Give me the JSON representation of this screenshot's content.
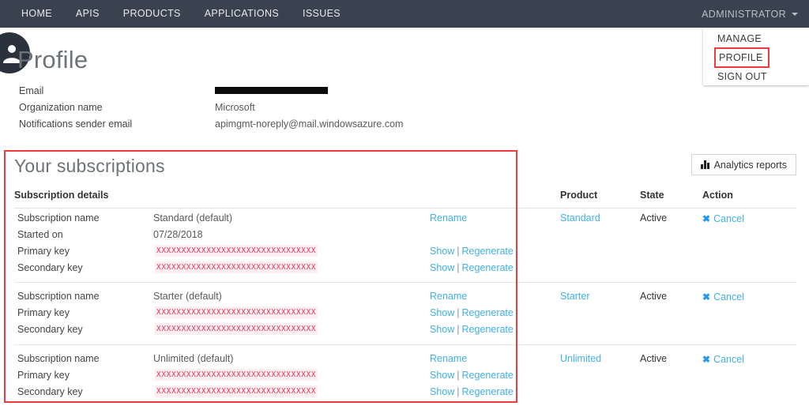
{
  "navbar": {
    "items": [
      {
        "label": "HOME",
        "name": "nav-home"
      },
      {
        "label": "APIS",
        "name": "nav-apis"
      },
      {
        "label": "PRODUCTS",
        "name": "nav-products"
      },
      {
        "label": "APPLICATIONS",
        "name": "nav-applications"
      },
      {
        "label": "ISSUES",
        "name": "nav-issues"
      }
    ],
    "user_menu_label": "ADMINISTRATOR",
    "caret_icon": "chevron-down-icon"
  },
  "dropdown": {
    "items": [
      {
        "label": "MANAGE",
        "highlighted": false
      },
      {
        "label": "PROFILE",
        "highlighted": true
      },
      {
        "label": "SIGN OUT",
        "highlighted": false
      }
    ],
    "highlight_color": "#ee3b3b"
  },
  "profile": {
    "title": "Profile",
    "avatar_icon": "user-avatar-icon",
    "avatar_color": "#2c323d",
    "fields": [
      {
        "label": "Email",
        "value": "",
        "redacted": true
      },
      {
        "label": "Organization name",
        "value": "Microsoft",
        "redacted": false
      },
      {
        "label": "Notifications sender email",
        "value": "apimgmt-noreply@mail.windowsazure.com",
        "redacted": false
      }
    ]
  },
  "subscriptions": {
    "title": "Your subscriptions",
    "analytics_button": {
      "label": "Analytics reports",
      "icon": "bar-chart-icon"
    },
    "columns": {
      "details": "Subscription details",
      "product": "Product",
      "state": "State",
      "action": "Action"
    },
    "labels": {
      "subscription_name": "Subscription name",
      "started_on": "Started on",
      "primary_key": "Primary key",
      "secondary_key": "Secondary key",
      "rename": "Rename",
      "show": "Show",
      "regenerate": "Regenerate",
      "separator": "|",
      "cancel": "Cancel",
      "cancel_icon": "close-x-icon"
    },
    "masked_key": "XXXXXXXXXXXXXXXXXXXXXXXXXXXXXXXX",
    "rows": [
      {
        "subscription_name": "Standard (default)",
        "started_on": "07/28/2018",
        "has_started_on": true,
        "product": "Standard",
        "state": "Active",
        "action": "Cancel"
      },
      {
        "subscription_name": "Starter (default)",
        "started_on": "",
        "has_started_on": false,
        "product": "Starter",
        "state": "Active",
        "action": "Cancel"
      },
      {
        "subscription_name": "Unlimited (default)",
        "started_on": "",
        "has_started_on": false,
        "product": "Unlimited",
        "state": "Active",
        "action": "Cancel"
      }
    ]
  },
  "colors": {
    "navbar_bg": "#3a4250",
    "link_blue": "#41b0e8",
    "key_red": "#e0385c",
    "highlight_red": "#ee3b3b"
  }
}
